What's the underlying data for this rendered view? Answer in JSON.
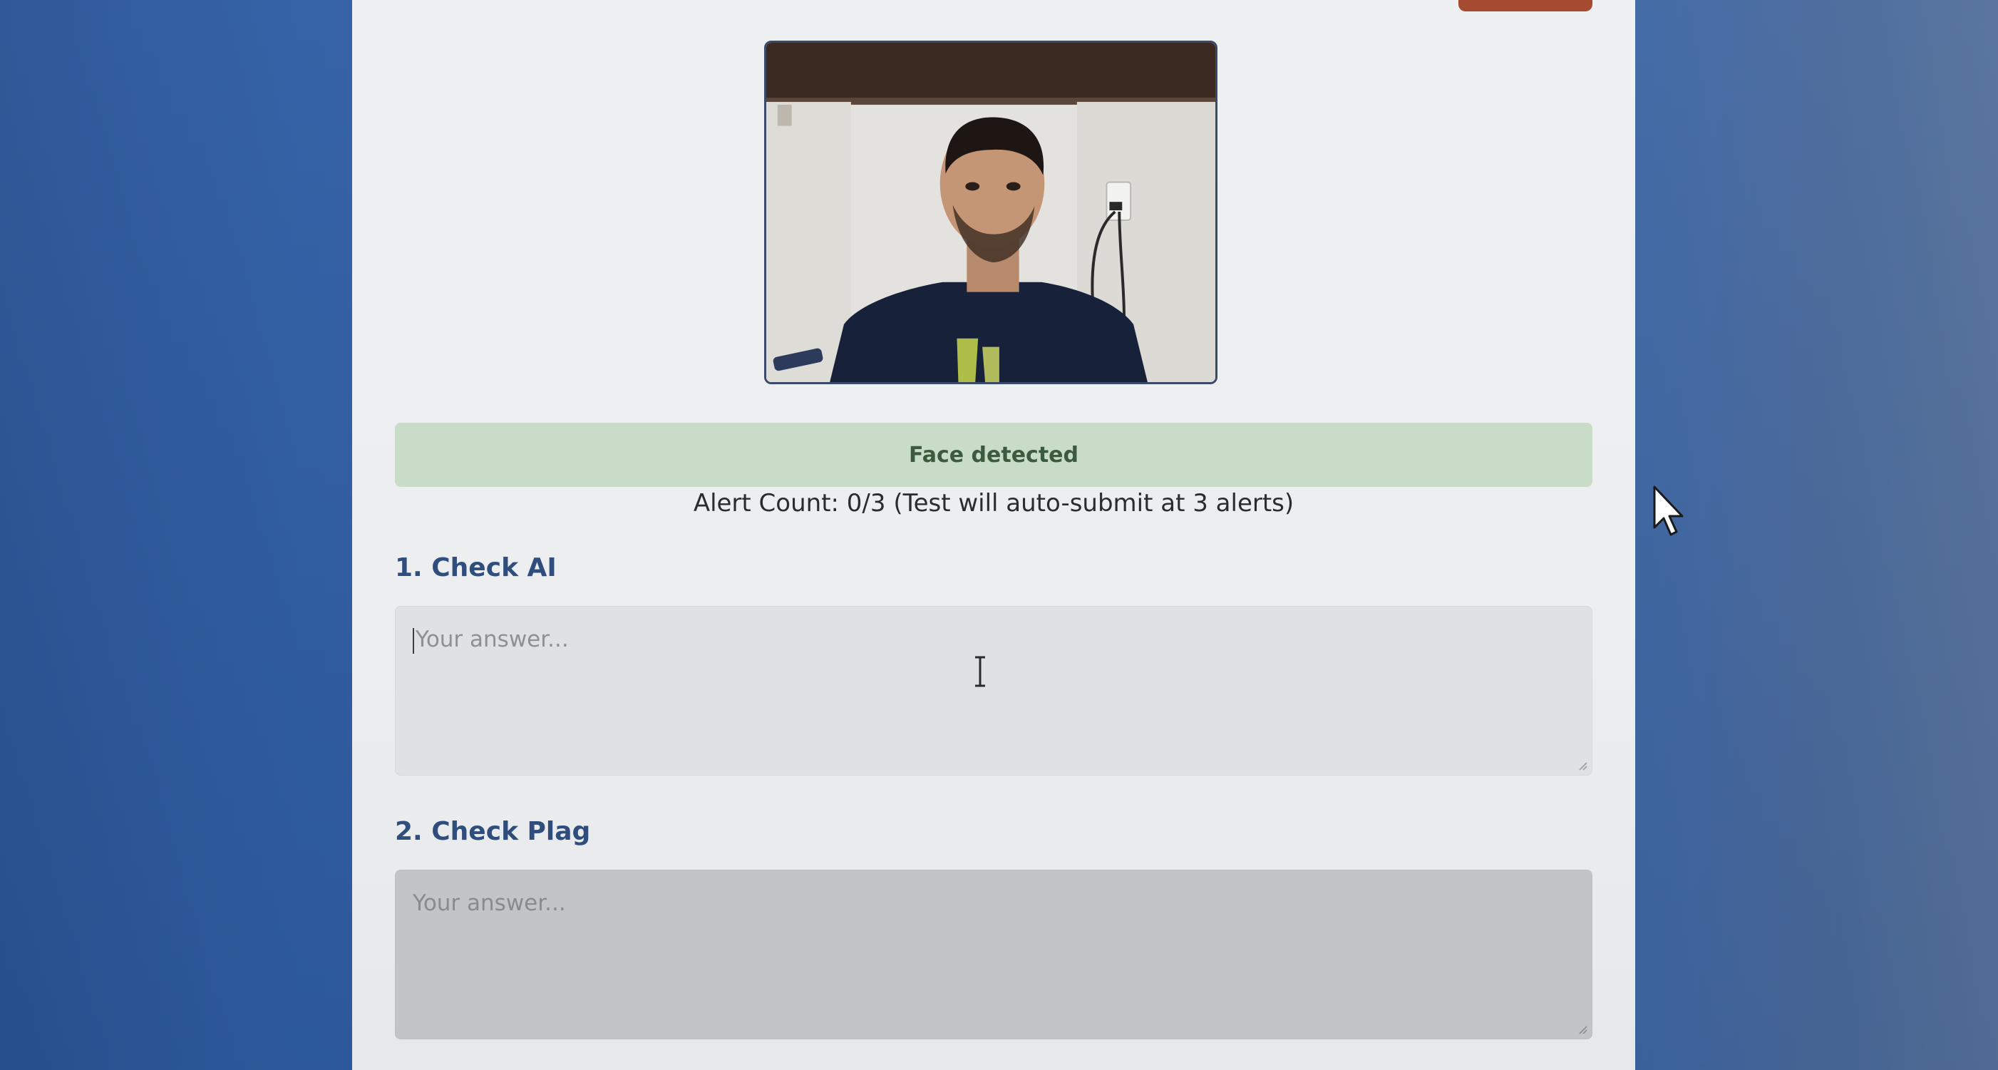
{
  "status": {
    "face_message": "Face detected",
    "alert_count_text": "Alert Count: 0/3 (Test will auto-submit at 3 alerts)"
  },
  "questions": [
    {
      "title": "1. Check AI",
      "placeholder": "Your answer..."
    },
    {
      "title": "2. Check Plag",
      "placeholder": "Your answer..."
    }
  ],
  "colors": {
    "background": "#3462a8",
    "card": "#eceef0",
    "status_banner": "#c9dcc7",
    "status_text": "#3c5a3e",
    "question_title": "#2f4e7e",
    "top_button": "#a64a32"
  },
  "icons": [
    "webcam-feed",
    "text-cursor-icon",
    "mouse-pointer-icon",
    "resize-handle-icon"
  ]
}
